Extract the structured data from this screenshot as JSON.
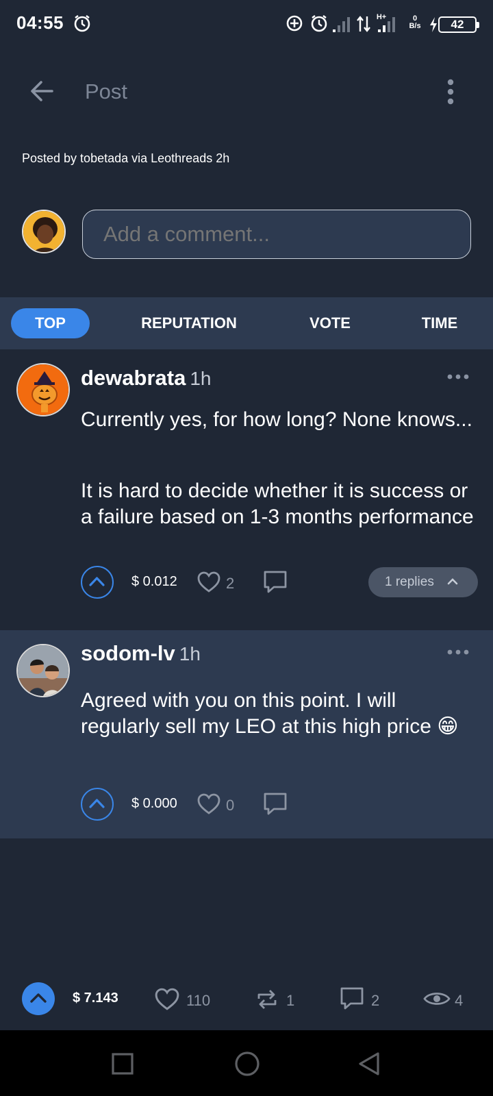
{
  "status_bar": {
    "time": "04:55",
    "network_label": "H+",
    "speed_value": "0",
    "speed_unit": "B/s",
    "battery": "42"
  },
  "header": {
    "title": "Post"
  },
  "post_meta": {
    "posted_by": "Posted by tobetada via Leothreads 2h"
  },
  "composer": {
    "placeholder": "Add a comment..."
  },
  "sort_tabs": [
    {
      "label": "TOP",
      "active": true
    },
    {
      "label": "REPUTATION",
      "active": false
    },
    {
      "label": "VOTE",
      "active": false
    },
    {
      "label": "TIME",
      "active": false
    }
  ],
  "comments": [
    {
      "author": "dewabrata",
      "age": "1h",
      "paragraphs": [
        "Currently yes, for how long? None knows...",
        "It is hard to decide whether it is success or a failure based on 1-3 months performance"
      ],
      "amount": "$ 0.012",
      "likes": "2",
      "replies_label": "1 replies"
    },
    {
      "author": "sodom-lv",
      "age": "1h",
      "paragraphs": [
        "Agreed with you on this point. I will regularly sell my LEO at this high price 😁"
      ],
      "amount": "$ 0.000",
      "likes": "0"
    }
  ],
  "bottom_actions": {
    "amount": "$ 7.143",
    "likes": "110",
    "reposts": "1",
    "comments": "2",
    "views": "4"
  },
  "colors": {
    "background": "#1f2735",
    "panel": "#2d3a50",
    "accent": "#3a86e8",
    "muted": "#8d95a3"
  }
}
